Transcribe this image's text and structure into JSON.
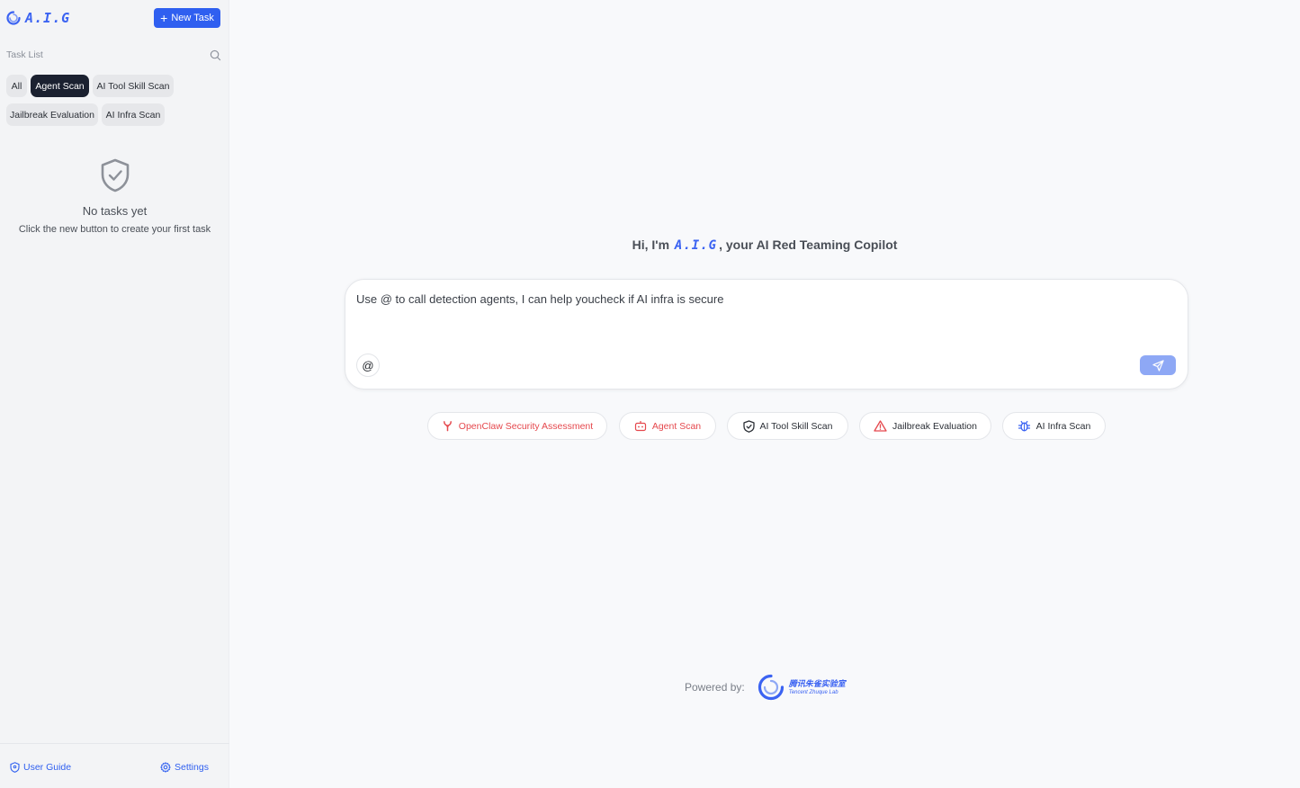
{
  "app": {
    "logo_text": "A.I.G"
  },
  "sidebar": {
    "new_task_label": "New Task",
    "task_list_title": "Task List",
    "filters": [
      "All",
      "Agent Scan",
      "AI Tool Skill Scan",
      "Jailbreak Evaluation",
      "AI Infra Scan"
    ],
    "active_filter": "Agent Scan",
    "empty_title": "No tasks yet",
    "empty_subtitle": "Click the new button to create your first task",
    "footer": {
      "user_guide": "User Guide",
      "settings": "Settings"
    }
  },
  "main": {
    "greeting_prefix": "Hi, I'm",
    "greeting_brand": "A.I.G",
    "greeting_suffix": ", your AI Red Teaming Copilot",
    "input_placeholder": "Use @ to call detection agents, I can help youcheck if AI infra is secure",
    "at_symbol": "@",
    "quick_actions": [
      {
        "label": "OpenClaw Security Assessment",
        "icon": "claw-icon"
      },
      {
        "label": "Agent Scan",
        "icon": "robot-icon"
      },
      {
        "label": "AI Tool Skill Scan",
        "icon": "shield-check-icon"
      },
      {
        "label": "Jailbreak Evaluation",
        "icon": "warning-icon"
      },
      {
        "label": "AI Infra Scan",
        "icon": "bug-icon"
      }
    ],
    "powered_by": "Powered by:",
    "lab_name_cn": "腾讯朱雀实验室",
    "lab_name_en": "Tencent Zhuque Lab"
  },
  "colors": {
    "accent": "#2f5ff0",
    "brand": "#3b63f2",
    "danger": "#e5484d",
    "active_chip": "#1b2130"
  }
}
